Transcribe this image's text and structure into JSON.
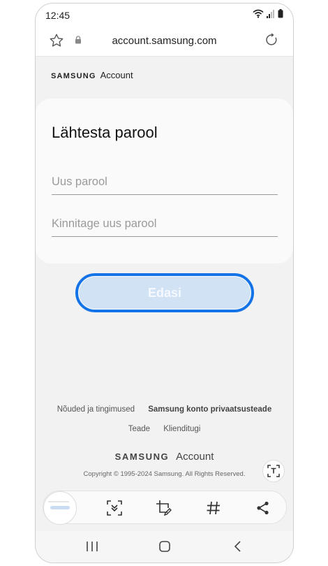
{
  "status": {
    "time": "12:45"
  },
  "browser": {
    "url": "account.samsung.com"
  },
  "brand": {
    "samsung": "SAMSUNG",
    "account": "Account"
  },
  "form": {
    "title": "Lähtesta parool",
    "new_password_placeholder": "Uus parool",
    "confirm_password_placeholder": "Kinnitage uus parool",
    "next_label": "Edasi"
  },
  "footer": {
    "terms": "Nõuded ja tingimused",
    "privacy": "Samsung konto privaatsusteade",
    "notice": "Teade",
    "support": "Klienditugi",
    "copyright": "Copyright © 1995-2024 Samsung. All Rights Reserved."
  },
  "colors": {
    "accent": "#1473e6",
    "button_fill": "#d1e2f5",
    "background": "#f2f2f2"
  },
  "icons": {
    "toolbar": [
      "scan-icon",
      "crop-edit-icon",
      "hashtag-icon",
      "share-icon"
    ],
    "nav": [
      "recents-icon",
      "home-icon",
      "back-icon"
    ]
  }
}
